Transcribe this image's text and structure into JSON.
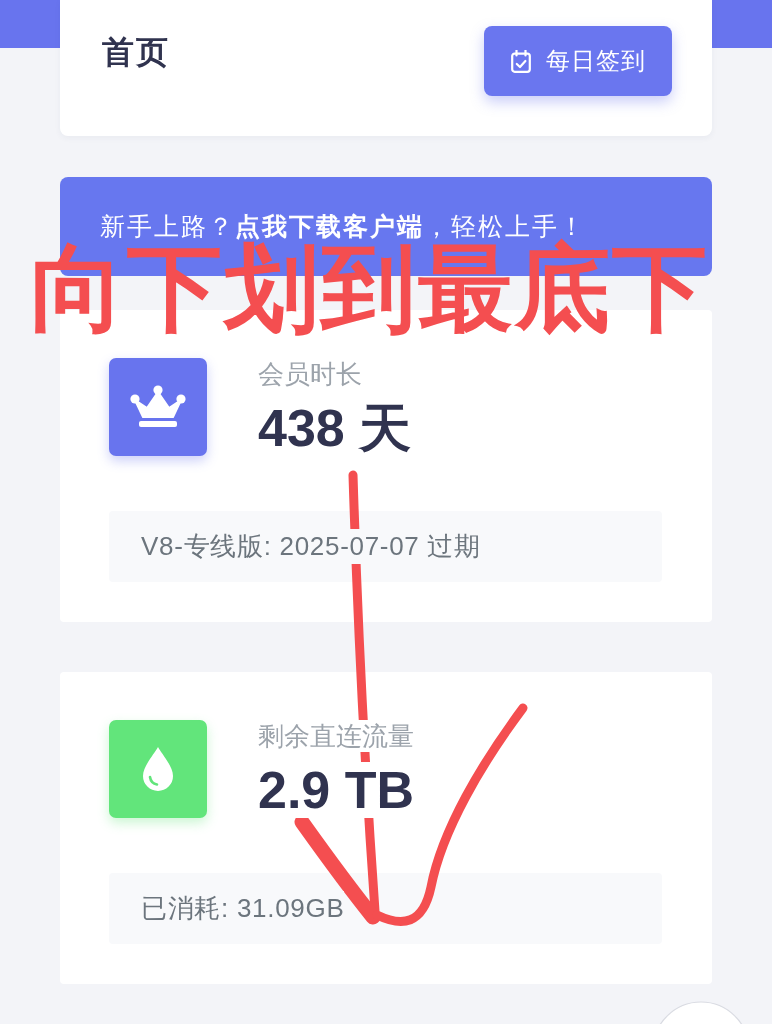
{
  "header": {
    "title": "首页",
    "checkin_button": {
      "label": "每日签到"
    }
  },
  "banner": {
    "text": "新手上路？**点我下载客户端**，轻松上手！"
  },
  "stats": [
    {
      "kind": "membership",
      "color": "#6874ee",
      "label": "会员时长",
      "value": "438 天",
      "detail": "V8-专线版: 2025-07-07 过期"
    },
    {
      "kind": "traffic",
      "color": "#62e57b",
      "label": "剩余直连流量",
      "value": "2.9 TB",
      "detail": "已消耗: 31.09GB"
    }
  ],
  "annotation": {
    "text": "向下划到最底下"
  }
}
